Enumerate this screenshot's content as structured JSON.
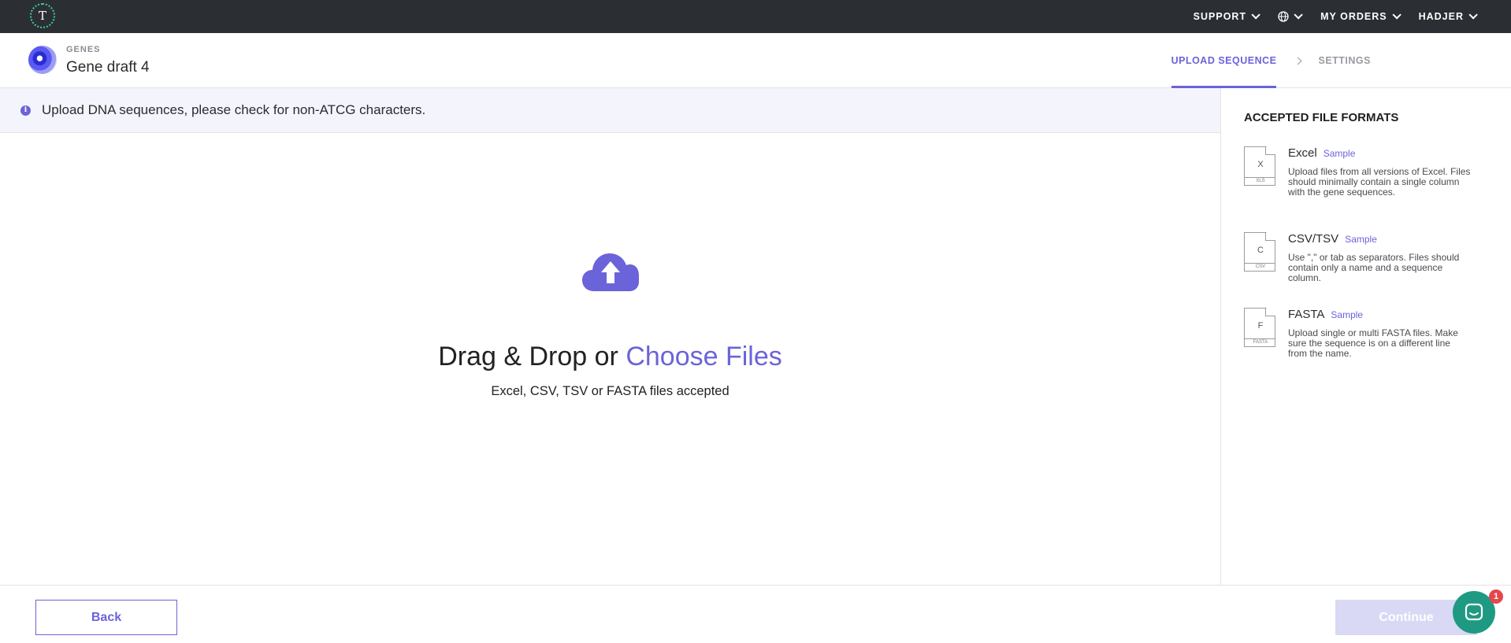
{
  "topbar": {
    "logo_letter": "T",
    "nav": [
      {
        "label": "SUPPORT"
      },
      {
        "label": ""
      },
      {
        "label": "MY ORDERS"
      },
      {
        "label": "HADJER"
      }
    ]
  },
  "header": {
    "breadcrumb": "GENES",
    "title": "Gene draft 4",
    "steps": [
      {
        "label": "UPLOAD SEQUENCE",
        "state": "active"
      },
      {
        "label": "SETTINGS",
        "state": "inactive"
      }
    ]
  },
  "banner": {
    "icon_letter": "i",
    "text": "Upload DNA sequences, please check for non-ATCG characters."
  },
  "dropzone": {
    "title_prefix": "Drag & Drop or ",
    "choose_label": "Choose Files",
    "subtitle": "Excel, CSV, TSV or FASTA files accepted"
  },
  "formats": {
    "title": "ACCEPTED FILE FORMATS",
    "items": [
      {
        "letter": "X",
        "ext": "XLS",
        "name": "Excel",
        "sample": "Sample",
        "desc": "Upload files from all versions of Excel. Files should minimally contain a single column with the gene sequences."
      },
      {
        "letter": "C",
        "ext": "CSV",
        "name": "CSV/TSV",
        "sample": "Sample",
        "desc": "Use \",\" or tab as separators. Files should contain only a name and a sequence column."
      },
      {
        "letter": "F",
        "ext": "FASTA",
        "name": "FASTA",
        "sample": "Sample",
        "desc": "Upload single or multi FASTA files. Make sure the sequence is on a different line from the name."
      }
    ]
  },
  "footer": {
    "back_label": "Back",
    "continue_label": "Continue",
    "chat_badge": "1"
  },
  "colors": {
    "accent": "#6b63d9",
    "topbar": "#2b2f33",
    "chat": "#1f9a82",
    "badge": "#e4474c"
  }
}
